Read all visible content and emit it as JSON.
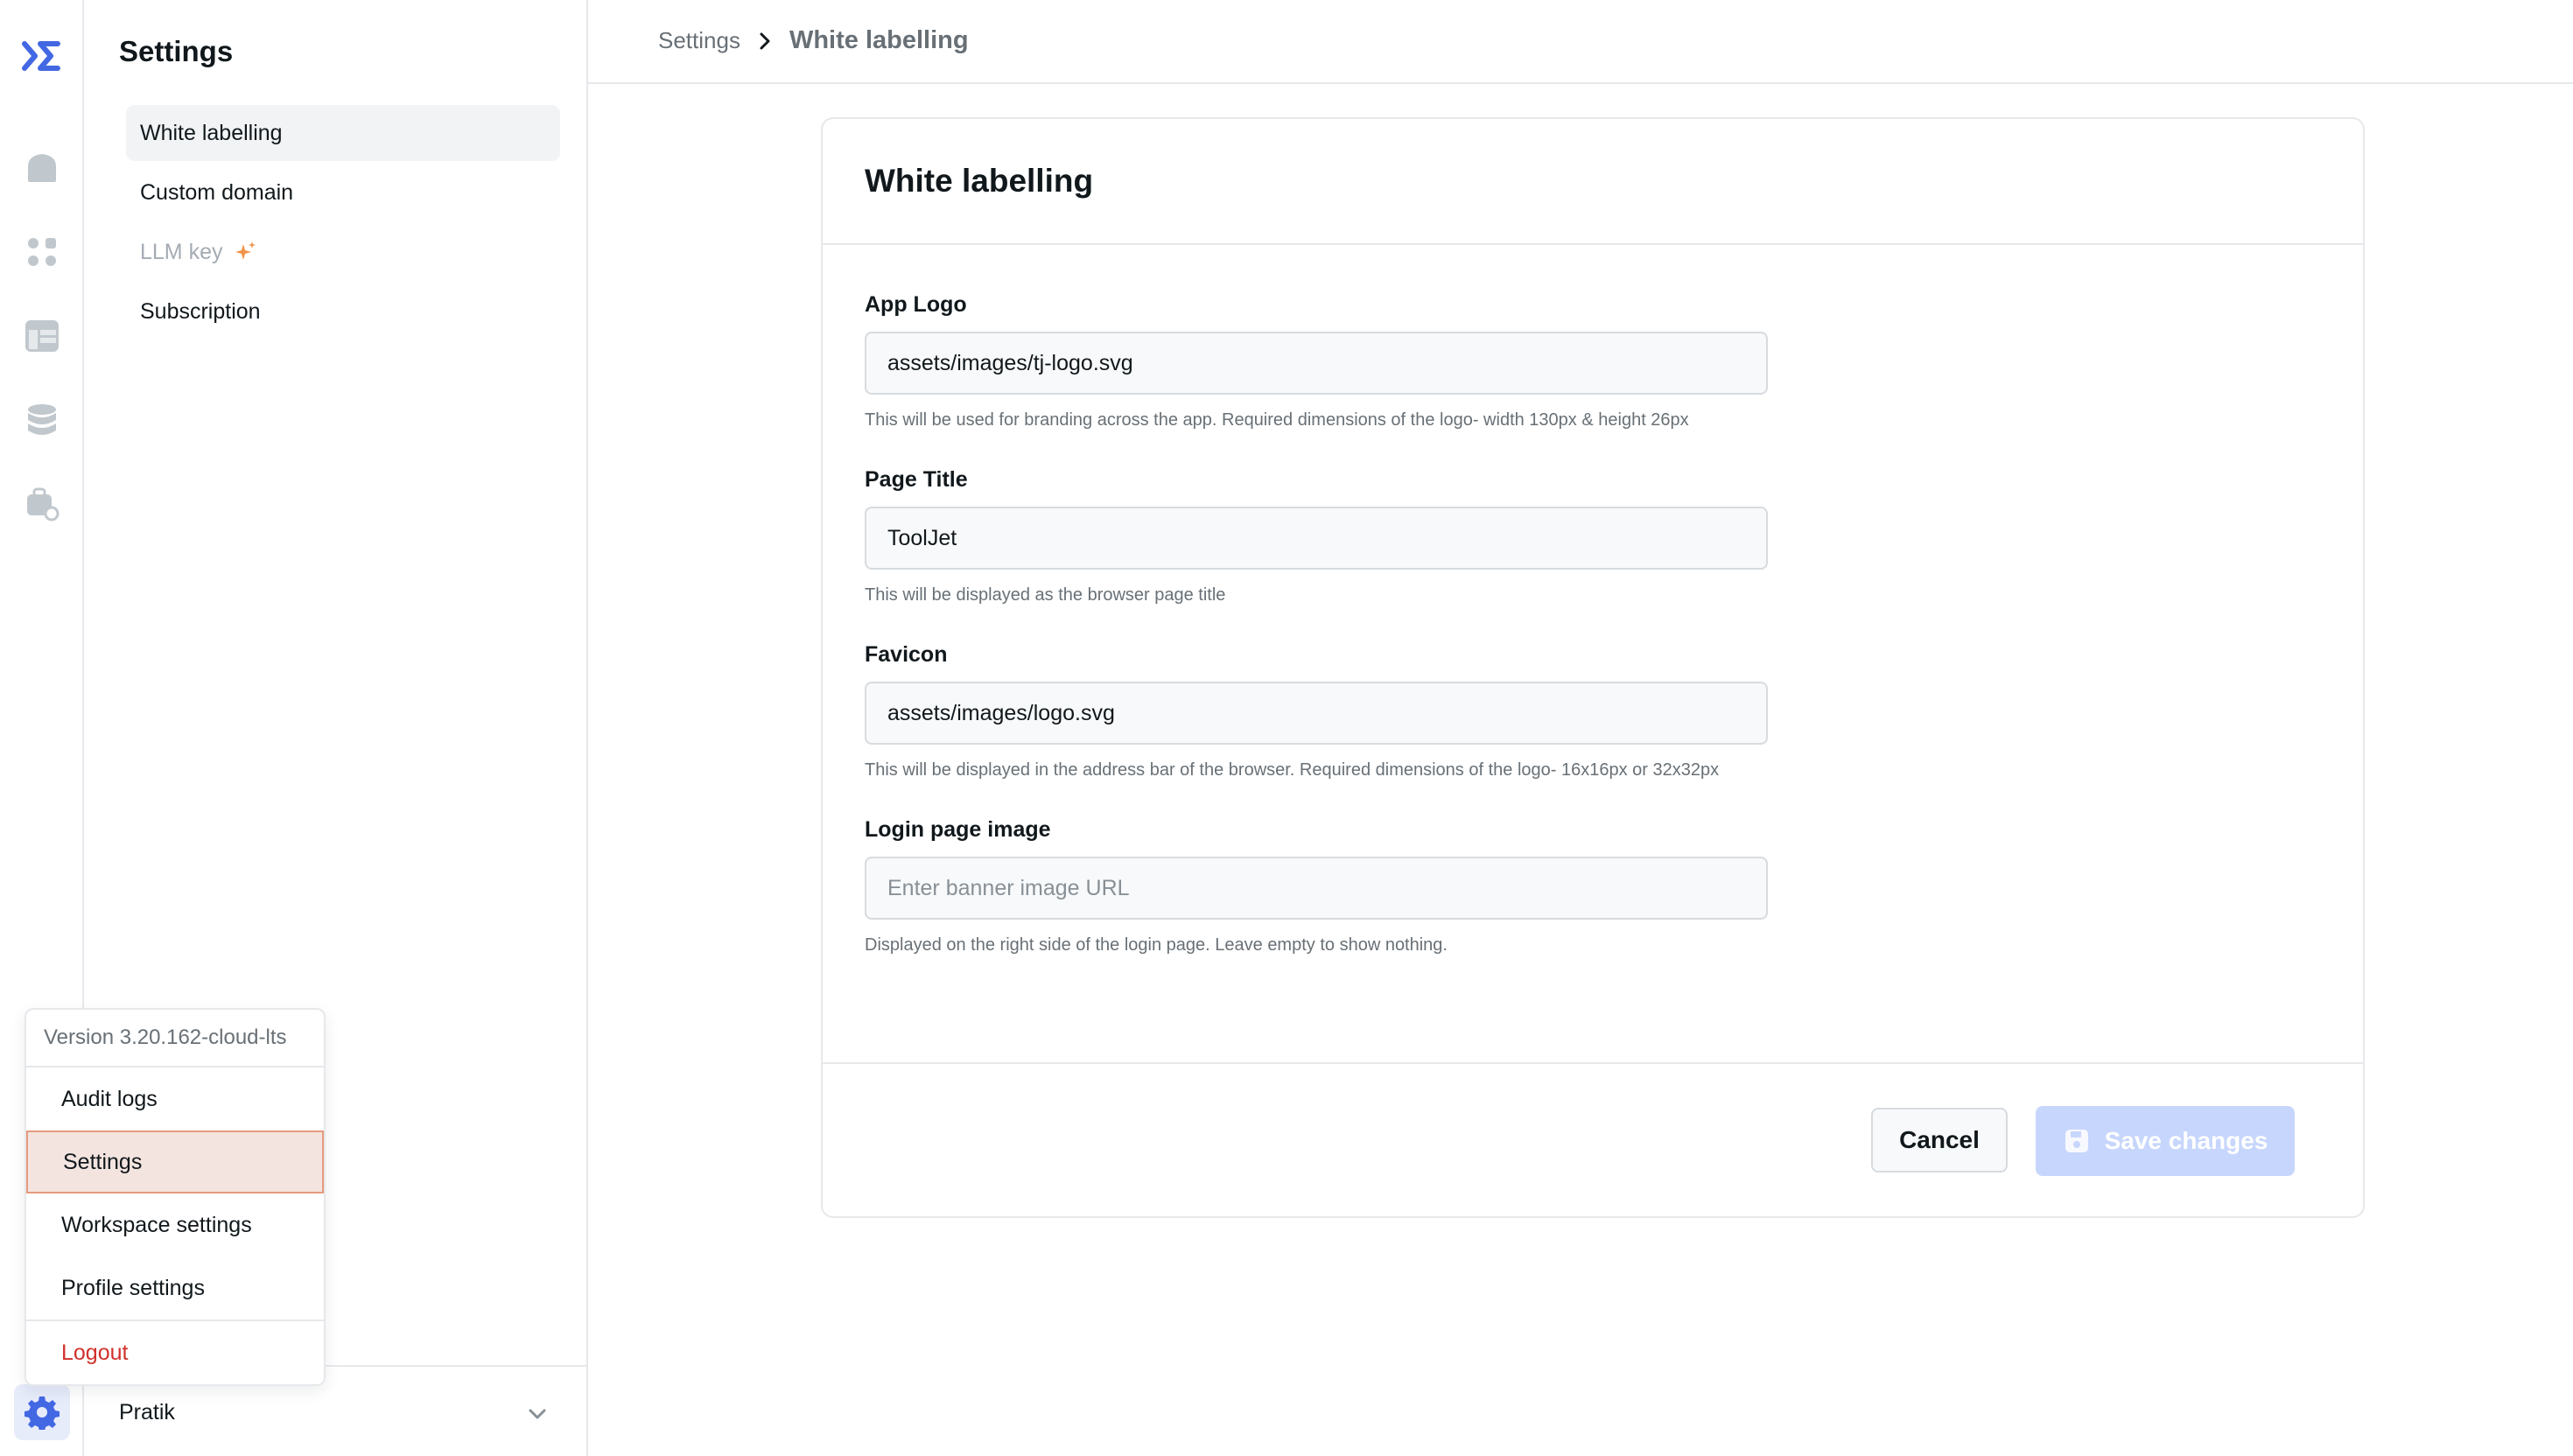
{
  "colors": {
    "accent": "#4368e3",
    "danger": "#d1302b",
    "sparkle": "#f19248"
  },
  "rail": {
    "icons": [
      "tooljet-logo-icon",
      "home-icon",
      "apps-grid-icon",
      "table-icon",
      "database-icon",
      "workflow-icon",
      "gear-icon"
    ]
  },
  "sidebar": {
    "title": "Settings",
    "items": [
      {
        "label": "White labelling"
      },
      {
        "label": "Custom domain"
      },
      {
        "label": "LLM key"
      },
      {
        "label": "Subscription"
      }
    ],
    "user": "Pratik"
  },
  "menu": {
    "version": "Version 3.20.162-cloud-lts",
    "items": [
      {
        "label": "Audit logs"
      },
      {
        "label": "Settings"
      },
      {
        "label": "Workspace settings"
      },
      {
        "label": "Profile settings"
      },
      {
        "label": "Logout"
      }
    ]
  },
  "breadcrumb": {
    "root": "Settings",
    "current": "White labelling"
  },
  "card": {
    "title": "White labelling",
    "fields": [
      {
        "label": "App Logo",
        "value": "assets/images/tj-logo.svg",
        "help": "This will be used for branding across the app. Required dimensions of the logo- width 130px & height 26px"
      },
      {
        "label": "Page Title",
        "value": "ToolJet",
        "help": "This will be displayed as the browser page title"
      },
      {
        "label": "Favicon",
        "value": "assets/images/logo.svg",
        "help": "This will be displayed in the address bar of the browser. Required dimensions of the logo- 16x16px or 32x32px"
      },
      {
        "label": "Login page image",
        "placeholder": "Enter banner image URL",
        "help": "Displayed on the right side of the login page. Leave empty to show nothing."
      }
    ],
    "cancel_label": "Cancel",
    "save_label": "Save changes"
  }
}
